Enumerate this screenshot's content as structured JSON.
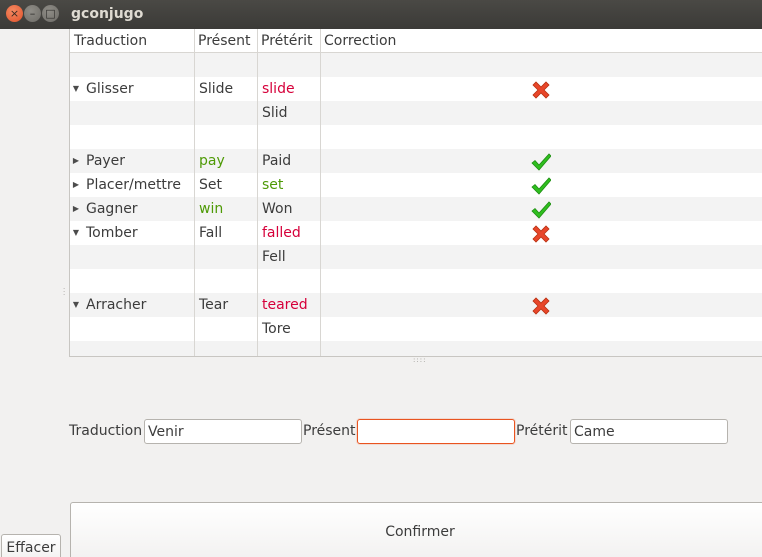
{
  "window": {
    "title": "gconjugo",
    "close_glyph": "×",
    "min_glyph": "–",
    "max_glyph": "□"
  },
  "table": {
    "headers": [
      "Traduction",
      "Présent",
      "Prétérit",
      "Correction"
    ],
    "rows": [
      {
        "expander": "",
        "traduction": "",
        "present": "",
        "present_color": "black",
        "preterit": "",
        "preterit_color": "black",
        "correction": ""
      },
      {
        "expander": "▼",
        "traduction": "Glisser",
        "present": "Slide",
        "present_color": "black",
        "preterit": "slide",
        "preterit_color": "red",
        "correction": "cross-icon"
      },
      {
        "expander": "",
        "traduction": "",
        "present": "",
        "present_color": "black",
        "preterit": "Slid",
        "preterit_color": "black",
        "correction": ""
      },
      {
        "expander": "",
        "traduction": "",
        "present": "",
        "present_color": "black",
        "preterit": "",
        "preterit_color": "black",
        "correction": ""
      },
      {
        "expander": "▶",
        "traduction": "Payer",
        "present": "pay",
        "present_color": "green",
        "preterit": "Paid",
        "preterit_color": "black",
        "correction": "check-icon"
      },
      {
        "expander": "▶",
        "traduction": "Placer/mettre",
        "present": "Set",
        "present_color": "black",
        "preterit": "set",
        "preterit_color": "green",
        "correction": "check-icon"
      },
      {
        "expander": "▶",
        "traduction": "Gagner",
        "present": "win",
        "present_color": "green",
        "preterit": "Won",
        "preterit_color": "black",
        "correction": "check-icon"
      },
      {
        "expander": "▼",
        "traduction": "Tomber",
        "present": "Fall",
        "present_color": "black",
        "preterit": "falled",
        "preterit_color": "red",
        "correction": "cross-icon"
      },
      {
        "expander": "",
        "traduction": "",
        "present": "",
        "present_color": "black",
        "preterit": "Fell",
        "preterit_color": "black",
        "correction": ""
      },
      {
        "expander": "",
        "traduction": "",
        "present": "",
        "present_color": "black",
        "preterit": "",
        "preterit_color": "black",
        "correction": ""
      },
      {
        "expander": "▼",
        "traduction": "Arracher",
        "present": "Tear",
        "present_color": "black",
        "preterit": "teared",
        "preterit_color": "red",
        "correction": "cross-icon"
      },
      {
        "expander": "",
        "traduction": "",
        "present": "",
        "present_color": "black",
        "preterit": "Tore",
        "preterit_color": "black",
        "correction": ""
      },
      {
        "expander": "",
        "traduction": "",
        "present": "",
        "present_color": "black",
        "preterit": "",
        "preterit_color": "black",
        "correction": ""
      }
    ]
  },
  "form": {
    "traduction_label": "Traduction",
    "traduction_value": "Venir",
    "present_label": "Présent",
    "present_value": "",
    "preterit_label": "Prétérit",
    "preterit_value": "Came"
  },
  "buttons": {
    "confirm": "Confirmer",
    "clear": "Effacer"
  },
  "colors": {
    "correct": "#4e9a06",
    "incorrect": "#d6003a",
    "focus": "#e95420",
    "check": "#2fbf1f",
    "cross": "#e8462a"
  }
}
